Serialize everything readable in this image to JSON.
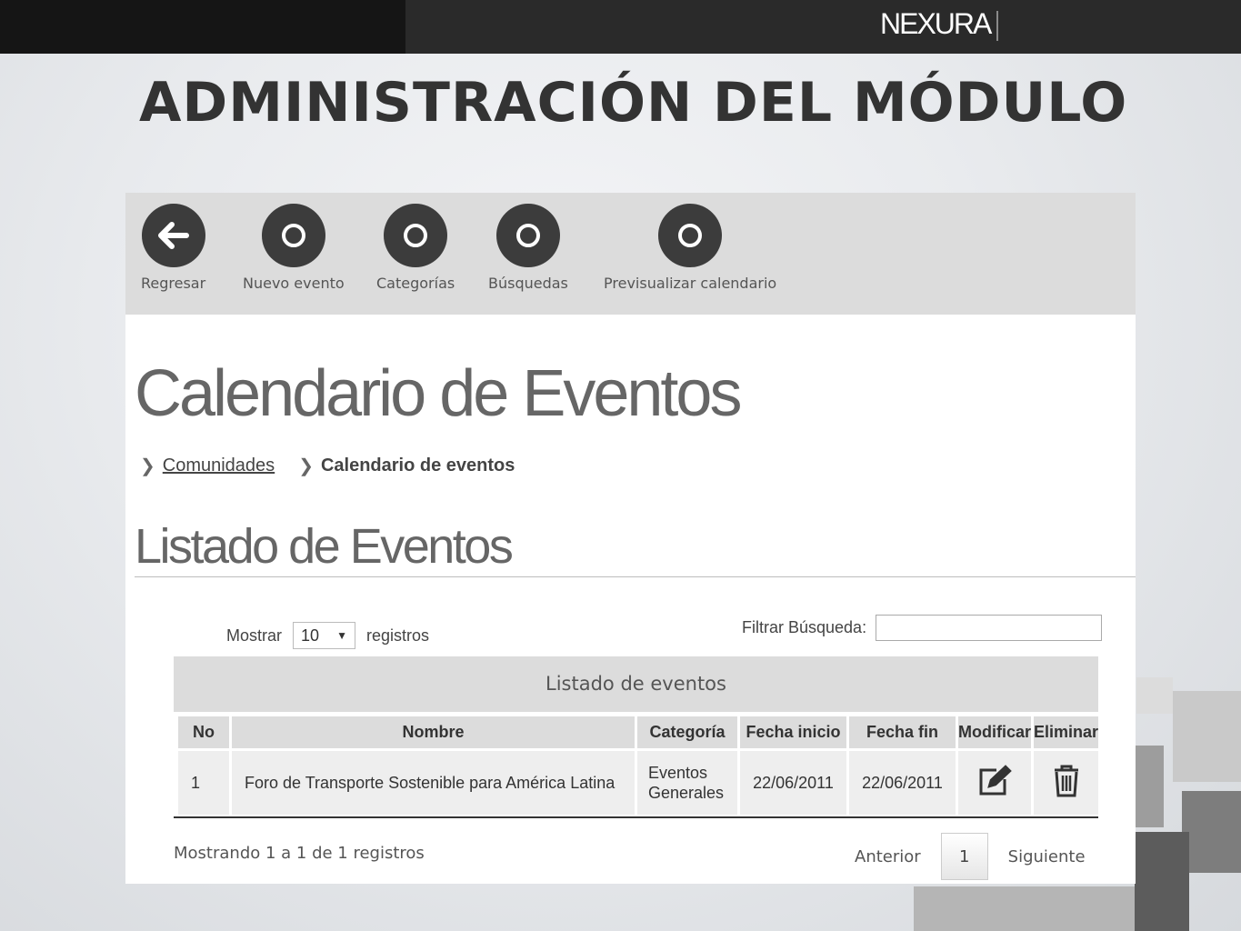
{
  "brand": {
    "logo_text": "NEXURA"
  },
  "slide": {
    "title": "ADMINISTRACIÓN DEL MÓDULO"
  },
  "toolbar": {
    "back": "Regresar",
    "new_event": "Nuevo evento",
    "categories": "Categorías",
    "searches": "Búsquedas",
    "preview": "Previsualizar calendario"
  },
  "page": {
    "heading": "Calendario de Eventos",
    "breadcrumb": {
      "parent": "Comunidades",
      "current": "Calendario de eventos"
    },
    "list_heading": "Listado de Eventos"
  },
  "controls": {
    "show_label": "Mostrar",
    "page_size": "10",
    "records_label": "registros",
    "filter_label": "Filtrar Búsqueda:",
    "filter_value": ""
  },
  "table": {
    "title": "Listado de eventos",
    "columns": [
      "No",
      "Nombre",
      "Categoría",
      "Fecha inicio",
      "Fecha fin",
      "Modificar",
      "Eliminar"
    ],
    "rows": [
      {
        "no": "1",
        "nombre": "Foro de Transporte Sostenible para América Latina",
        "categoria_l1": "Eventos",
        "categoria_l2": "Generales",
        "inicio": "22/06/2011",
        "fin": "22/06/2011"
      }
    ]
  },
  "footer": {
    "info": "Mostrando 1 a 1 de 1 registros",
    "prev": "Anterior",
    "page": "1",
    "next": "Siguiente"
  },
  "icons": {
    "back": "arrow-left-icon",
    "toolbar": "circle-icon",
    "edit": "edit-icon",
    "delete": "trash-icon"
  }
}
